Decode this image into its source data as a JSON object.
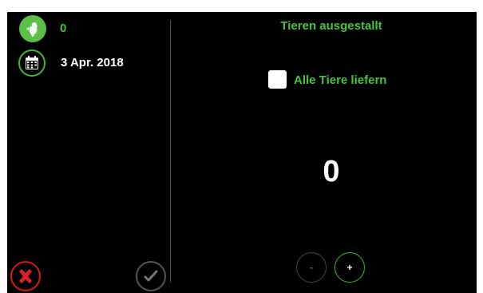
{
  "info": {
    "count": "0",
    "date": "3 Apr. 2018"
  },
  "main": {
    "title": "Tieren ausgestallt",
    "all_label": "Alle Tiere liefern",
    "all_checked": false,
    "amount": "0"
  },
  "stepper": {
    "minus_label": "-",
    "plus_label": "+"
  },
  "icons": {
    "count_badge": "bird-icon",
    "date_badge": "calendar-icon",
    "cancel": "close-icon",
    "confirm": "checkmark-icon"
  },
  "colors": {
    "accent": "#47c43b",
    "danger": "#d51a1a",
    "background": "#000000"
  }
}
